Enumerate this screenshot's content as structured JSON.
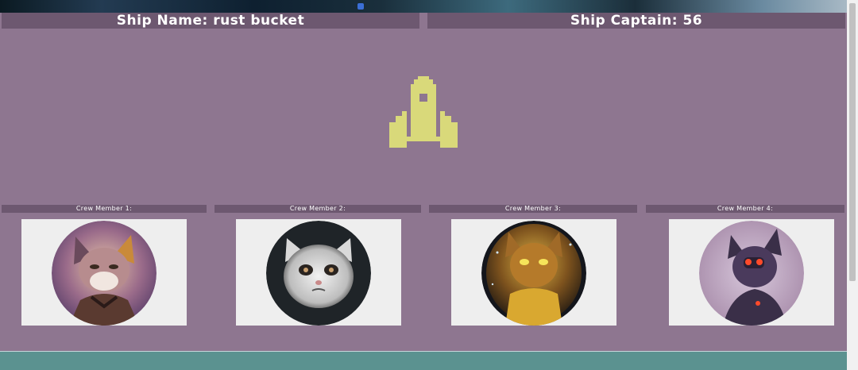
{
  "ship": {
    "name_label": "Ship Name: rust bucket",
    "captain_label": "Ship Captain: 56",
    "icon": "rocket-icon",
    "icon_color": "#d9d97a"
  },
  "colors": {
    "panel": "#8e7690",
    "header": "#6d5870",
    "page_bg": "#5b9290",
    "card_bg": "#eeeeee"
  },
  "crew": [
    {
      "label": "Crew Member 1:",
      "portrait": "cat-portrait-1"
    },
    {
      "label": "Crew Member 2:",
      "portrait": "cat-portrait-2"
    },
    {
      "label": "Crew Member 3:",
      "portrait": "cat-portrait-3"
    },
    {
      "label": "Crew Member 4:",
      "portrait": "cat-portrait-4"
    }
  ]
}
